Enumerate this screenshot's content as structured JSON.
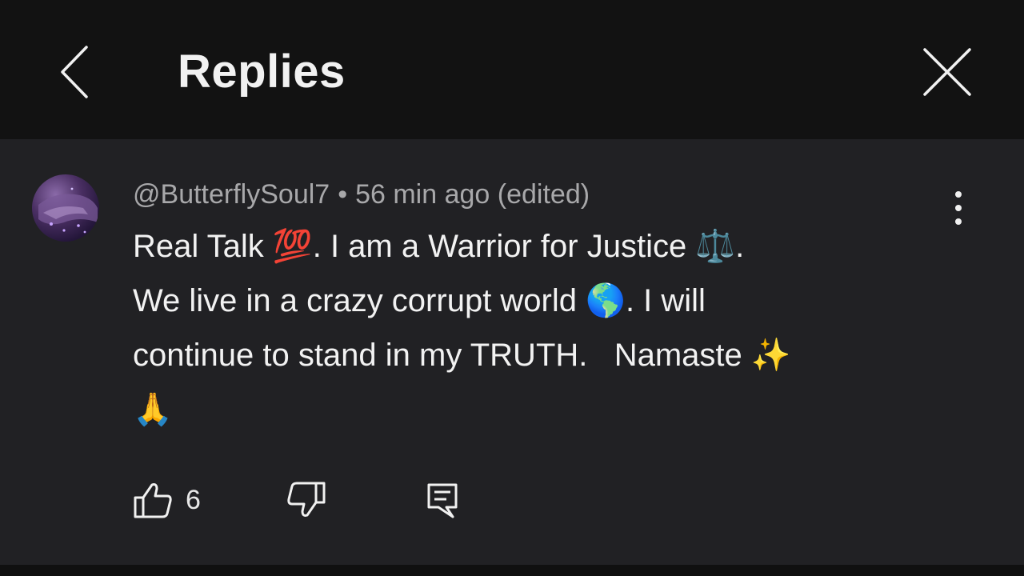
{
  "header": {
    "title": "Replies",
    "back_icon": "chevron-left-icon",
    "close_icon": "close-icon"
  },
  "comment": {
    "author": "@ButterflySoul7",
    "separator": "•",
    "time": "56 min ago (edited)",
    "lines": [
      [
        "Real Talk ",
        "💯",
        ". I am a Warrior for Justice ",
        "⚖️",
        "."
      ],
      [
        "We live in a crazy corrupt world ",
        "🌎",
        ". I  will"
      ],
      [
        "continue to stand in my TRUTH.   Namaste ",
        "✨"
      ],
      [
        "🙏"
      ]
    ],
    "likes": "6",
    "more_icon": "more-vertical-icon"
  },
  "actions": {
    "like_icon": "thumbs-up-icon",
    "dislike_icon": "thumbs-down-icon",
    "reply_icon": "reply-icon"
  },
  "colors": {
    "header_bg": "#121212",
    "comment_bg": "#212124",
    "primary_text": "#f2f2f2",
    "secondary_text": "#a8a8aa"
  }
}
